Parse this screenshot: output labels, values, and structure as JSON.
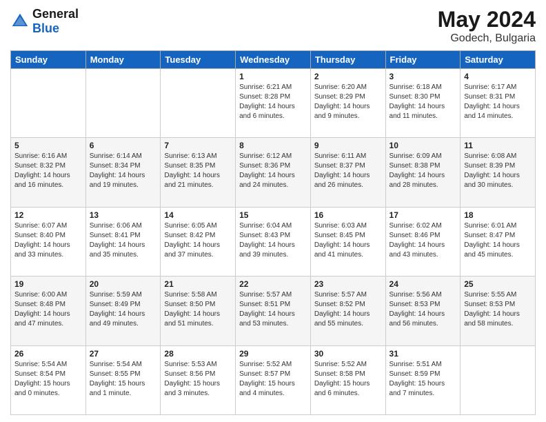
{
  "header": {
    "logo_text_general": "General",
    "logo_text_blue": "Blue",
    "month": "May 2024",
    "location": "Godech, Bulgaria"
  },
  "days_of_week": [
    "Sunday",
    "Monday",
    "Tuesday",
    "Wednesday",
    "Thursday",
    "Friday",
    "Saturday"
  ],
  "weeks": [
    [
      {
        "day": "",
        "sunrise": "",
        "sunset": "",
        "daylight": ""
      },
      {
        "day": "",
        "sunrise": "",
        "sunset": "",
        "daylight": ""
      },
      {
        "day": "",
        "sunrise": "",
        "sunset": "",
        "daylight": ""
      },
      {
        "day": "1",
        "sunrise": "Sunrise: 6:21 AM",
        "sunset": "Sunset: 8:28 PM",
        "daylight": "Daylight: 14 hours and 6 minutes."
      },
      {
        "day": "2",
        "sunrise": "Sunrise: 6:20 AM",
        "sunset": "Sunset: 8:29 PM",
        "daylight": "Daylight: 14 hours and 9 minutes."
      },
      {
        "day": "3",
        "sunrise": "Sunrise: 6:18 AM",
        "sunset": "Sunset: 8:30 PM",
        "daylight": "Daylight: 14 hours and 11 minutes."
      },
      {
        "day": "4",
        "sunrise": "Sunrise: 6:17 AM",
        "sunset": "Sunset: 8:31 PM",
        "daylight": "Daylight: 14 hours and 14 minutes."
      }
    ],
    [
      {
        "day": "5",
        "sunrise": "Sunrise: 6:16 AM",
        "sunset": "Sunset: 8:32 PM",
        "daylight": "Daylight: 14 hours and 16 minutes."
      },
      {
        "day": "6",
        "sunrise": "Sunrise: 6:14 AM",
        "sunset": "Sunset: 8:34 PM",
        "daylight": "Daylight: 14 hours and 19 minutes."
      },
      {
        "day": "7",
        "sunrise": "Sunrise: 6:13 AM",
        "sunset": "Sunset: 8:35 PM",
        "daylight": "Daylight: 14 hours and 21 minutes."
      },
      {
        "day": "8",
        "sunrise": "Sunrise: 6:12 AM",
        "sunset": "Sunset: 8:36 PM",
        "daylight": "Daylight: 14 hours and 24 minutes."
      },
      {
        "day": "9",
        "sunrise": "Sunrise: 6:11 AM",
        "sunset": "Sunset: 8:37 PM",
        "daylight": "Daylight: 14 hours and 26 minutes."
      },
      {
        "day": "10",
        "sunrise": "Sunrise: 6:09 AM",
        "sunset": "Sunset: 8:38 PM",
        "daylight": "Daylight: 14 hours and 28 minutes."
      },
      {
        "day": "11",
        "sunrise": "Sunrise: 6:08 AM",
        "sunset": "Sunset: 8:39 PM",
        "daylight": "Daylight: 14 hours and 30 minutes."
      }
    ],
    [
      {
        "day": "12",
        "sunrise": "Sunrise: 6:07 AM",
        "sunset": "Sunset: 8:40 PM",
        "daylight": "Daylight: 14 hours and 33 minutes."
      },
      {
        "day": "13",
        "sunrise": "Sunrise: 6:06 AM",
        "sunset": "Sunset: 8:41 PM",
        "daylight": "Daylight: 14 hours and 35 minutes."
      },
      {
        "day": "14",
        "sunrise": "Sunrise: 6:05 AM",
        "sunset": "Sunset: 8:42 PM",
        "daylight": "Daylight: 14 hours and 37 minutes."
      },
      {
        "day": "15",
        "sunrise": "Sunrise: 6:04 AM",
        "sunset": "Sunset: 8:43 PM",
        "daylight": "Daylight: 14 hours and 39 minutes."
      },
      {
        "day": "16",
        "sunrise": "Sunrise: 6:03 AM",
        "sunset": "Sunset: 8:45 PM",
        "daylight": "Daylight: 14 hours and 41 minutes."
      },
      {
        "day": "17",
        "sunrise": "Sunrise: 6:02 AM",
        "sunset": "Sunset: 8:46 PM",
        "daylight": "Daylight: 14 hours and 43 minutes."
      },
      {
        "day": "18",
        "sunrise": "Sunrise: 6:01 AM",
        "sunset": "Sunset: 8:47 PM",
        "daylight": "Daylight: 14 hours and 45 minutes."
      }
    ],
    [
      {
        "day": "19",
        "sunrise": "Sunrise: 6:00 AM",
        "sunset": "Sunset: 8:48 PM",
        "daylight": "Daylight: 14 hours and 47 minutes."
      },
      {
        "day": "20",
        "sunrise": "Sunrise: 5:59 AM",
        "sunset": "Sunset: 8:49 PM",
        "daylight": "Daylight: 14 hours and 49 minutes."
      },
      {
        "day": "21",
        "sunrise": "Sunrise: 5:58 AM",
        "sunset": "Sunset: 8:50 PM",
        "daylight": "Daylight: 14 hours and 51 minutes."
      },
      {
        "day": "22",
        "sunrise": "Sunrise: 5:57 AM",
        "sunset": "Sunset: 8:51 PM",
        "daylight": "Daylight: 14 hours and 53 minutes."
      },
      {
        "day": "23",
        "sunrise": "Sunrise: 5:57 AM",
        "sunset": "Sunset: 8:52 PM",
        "daylight": "Daylight: 14 hours and 55 minutes."
      },
      {
        "day": "24",
        "sunrise": "Sunrise: 5:56 AM",
        "sunset": "Sunset: 8:53 PM",
        "daylight": "Daylight: 14 hours and 56 minutes."
      },
      {
        "day": "25",
        "sunrise": "Sunrise: 5:55 AM",
        "sunset": "Sunset: 8:53 PM",
        "daylight": "Daylight: 14 hours and 58 minutes."
      }
    ],
    [
      {
        "day": "26",
        "sunrise": "Sunrise: 5:54 AM",
        "sunset": "Sunset: 8:54 PM",
        "daylight": "Daylight: 15 hours and 0 minutes."
      },
      {
        "day": "27",
        "sunrise": "Sunrise: 5:54 AM",
        "sunset": "Sunset: 8:55 PM",
        "daylight": "Daylight: 15 hours and 1 minute."
      },
      {
        "day": "28",
        "sunrise": "Sunrise: 5:53 AM",
        "sunset": "Sunset: 8:56 PM",
        "daylight": "Daylight: 15 hours and 3 minutes."
      },
      {
        "day": "29",
        "sunrise": "Sunrise: 5:52 AM",
        "sunset": "Sunset: 8:57 PM",
        "daylight": "Daylight: 15 hours and 4 minutes."
      },
      {
        "day": "30",
        "sunrise": "Sunrise: 5:52 AM",
        "sunset": "Sunset: 8:58 PM",
        "daylight": "Daylight: 15 hours and 6 minutes."
      },
      {
        "day": "31",
        "sunrise": "Sunrise: 5:51 AM",
        "sunset": "Sunset: 8:59 PM",
        "daylight": "Daylight: 15 hours and 7 minutes."
      },
      {
        "day": "",
        "sunrise": "",
        "sunset": "",
        "daylight": ""
      }
    ]
  ]
}
